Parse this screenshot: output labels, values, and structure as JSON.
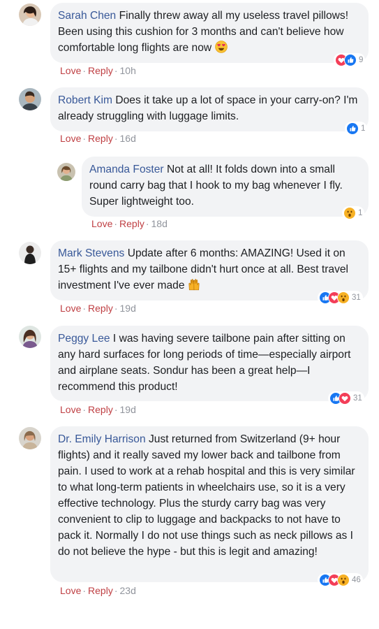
{
  "comments": [
    {
      "author": "Sarah Chen",
      "text": "Finally threw away all my useless travel pillows! Been using this cushion for 3 months and can't believe how comfortable long flights are now",
      "love": "Love",
      "reply": "Reply",
      "time": "10h",
      "reaction_count": "9",
      "reactions": [
        "love-reaction-icon",
        "like-reaction-icon"
      ],
      "emoji": "heart-eyes-emoji-icon"
    },
    {
      "author": "Robert Kim",
      "text": "Does it take up a lot of space in your carry-on? I'm already struggling with luggage limits.",
      "love": "Love",
      "reply": "Reply",
      "time": "16d",
      "reaction_count": "1",
      "reactions": [
        "like-reaction-icon"
      ]
    },
    {
      "author": "Amanda Foster",
      "text": "Not at all! It folds down into a small round carry bag that I hook to my bag whenever I fly. Super lightweight too.",
      "love": "Love",
      "reply": "Reply",
      "time": "18d",
      "reaction_count": "1",
      "reactions": [
        "wow-reaction-icon"
      ]
    },
    {
      "author": "Mark Stevens",
      "text": "Update after 6 months: AMAZING! Used it on 15+ flights and my tailbone didn't hurt once at all. Best travel investment I've ever made",
      "love": "Love",
      "reply": "Reply",
      "time": "19d",
      "reaction_count": "31",
      "reactions": [
        "like-reaction-icon",
        "love-reaction-icon",
        "wow-reaction-icon"
      ],
      "emoji": "raised-hands-emoji-icon"
    },
    {
      "author": "Peggy Lee",
      "text": "I was having severe tailbone pain after sitting on any hard surfaces for long periods of time—especially airport and airplane seats. Sondur has been a great help—I recommend this product!",
      "love": "Love",
      "reply": "Reply",
      "time": "19d",
      "reaction_count": "31",
      "reactions": [
        "like-reaction-icon",
        "love-reaction-icon"
      ]
    },
    {
      "author": "Dr. Emily Harrison",
      "text": "Just returned from Switzerland (9+ hour flights) and it really saved my lower back and tailbone from pain. I used to work at a rehab hospital and this is very similar to what long-term patients in wheelchairs use, so it is a very effective technology. Plus the sturdy carry bag was very convenient to clip to luggage and backpacks to not have to pack it. Normally I do not use things such as neck pillows as I do not believe the hype - but this is legit and amazing!",
      "love": "Love",
      "reply": "Reply",
      "time": "23d",
      "reaction_count": "46",
      "reactions": [
        "like-reaction-icon",
        "love-reaction-icon",
        "wow-reaction-icon"
      ]
    }
  ],
  "colors": {
    "author": "#385898",
    "love_action": "#bf3f43",
    "meta": "#90949c",
    "bubble": "#f2f3f5",
    "like": "#1877f2",
    "love": "#f33e58",
    "wow": "#f7b125"
  }
}
